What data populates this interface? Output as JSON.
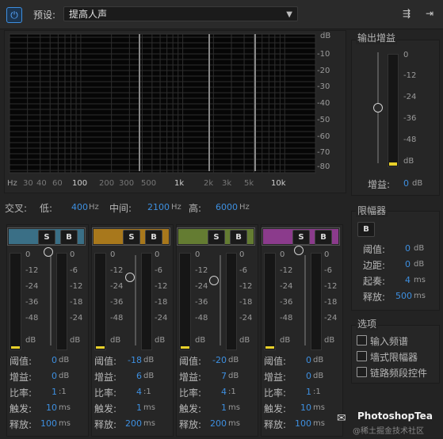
{
  "toolbar": {
    "preset_label": "预设:",
    "preset_value": "提高人声"
  },
  "spectrum": {
    "db_labels": [
      "dB",
      "-10",
      "-20",
      "-30",
      "-40",
      "-50",
      "-60",
      "-70",
      "-80"
    ],
    "hz_labels": [
      "Hz",
      "30",
      "40",
      "60",
      "100",
      "200",
      "300",
      "500",
      "1k",
      "2k",
      "3k",
      "5k",
      "10k"
    ]
  },
  "crossover": {
    "label": "交叉:",
    "low_label": "低:",
    "low_value": "400",
    "mid_label": "中间:",
    "mid_value": "2100",
    "high_label": "高:",
    "high_value": "6000",
    "unit": "Hz"
  },
  "bands": [
    {
      "color": "#3a6f86",
      "threshold": "0",
      "gain": "0",
      "ratio": "1",
      "attack": "10",
      "release": "100"
    },
    {
      "color": "#a8781c",
      "threshold": "-18",
      "gain": "6",
      "ratio": "4",
      "attack": "1",
      "release": "200"
    },
    {
      "color": "#647c32",
      "threshold": "-20",
      "gain": "7",
      "ratio": "4",
      "attack": "1",
      "release": "200"
    },
    {
      "color": "#8b3b8c",
      "threshold": "0",
      "gain": "0",
      "ratio": "1",
      "attack": "10",
      "release": "100"
    }
  ],
  "band_labels": {
    "solo": "S",
    "bypass": "B",
    "threshold": "阈值:",
    "gain": "增益:",
    "ratio": "比率:",
    "attack": "触发:",
    "release": "释放:",
    "db": "dB",
    "ratio_suffix": ":1",
    "ms": "ms"
  },
  "meter_scale_left": [
    "0",
    "-12",
    "-24",
    "-36",
    "-48",
    "dB"
  ],
  "meter_scale_right": [
    "0",
    "-6",
    "-12",
    "-18",
    "-24",
    "dB"
  ],
  "output": {
    "title": "输出增益",
    "scale": [
      "0",
      "-12",
      "-24",
      "-36",
      "-48",
      "dB"
    ],
    "gain_label": "增益:",
    "gain_value": "0",
    "gain_unit": "dB"
  },
  "limiter": {
    "title": "限幅器",
    "bypass": "B",
    "threshold_label": "阈值:",
    "threshold_value": "0",
    "margin_label": "边距:",
    "margin_value": "0",
    "attack_label": "起奏:",
    "attack_value": "4",
    "release_label": "释放:",
    "release_value": "500",
    "db": "dB",
    "ms": "ms"
  },
  "options": {
    "title": "选项",
    "items": [
      "输入频谱",
      "墙式限幅器",
      "链路频段控件"
    ]
  },
  "watermark": {
    "brand": "PhotoshopTea",
    "sub": "@稀土掘金技术社区"
  }
}
